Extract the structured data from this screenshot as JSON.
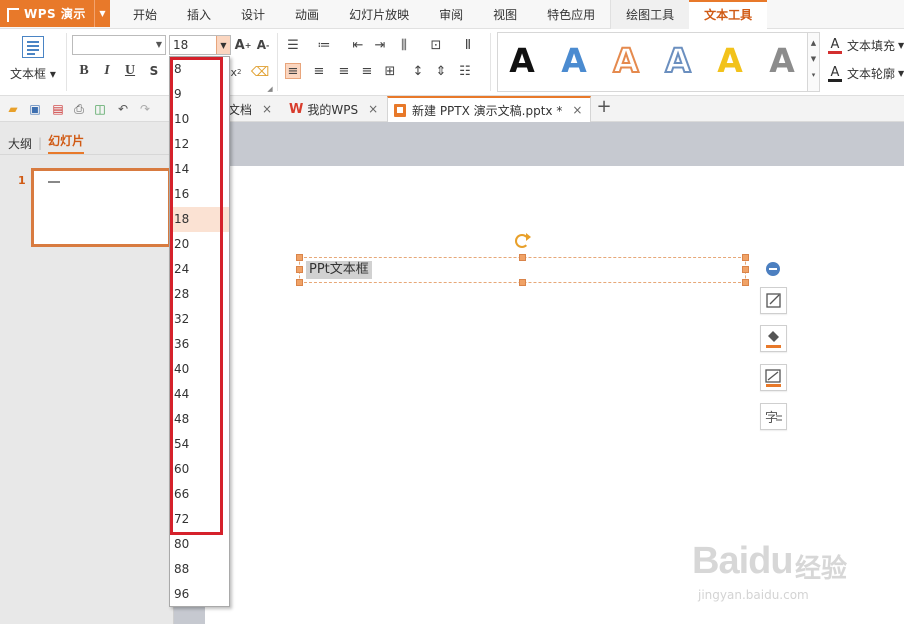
{
  "app": {
    "name": "WPS 演示"
  },
  "menu_tabs": [
    {
      "label": "开始",
      "kind": "normal"
    },
    {
      "label": "插入",
      "kind": "normal"
    },
    {
      "label": "设计",
      "kind": "normal"
    },
    {
      "label": "动画",
      "kind": "normal"
    },
    {
      "label": "幻灯片放映",
      "kind": "normal"
    },
    {
      "label": "审阅",
      "kind": "normal"
    },
    {
      "label": "视图",
      "kind": "normal"
    },
    {
      "label": "特色应用",
      "kind": "normal"
    },
    {
      "label": "绘图工具",
      "kind": "tool"
    },
    {
      "label": "文本工具",
      "kind": "active"
    }
  ],
  "ribbon": {
    "textbox_label": "文本框",
    "font_name": "",
    "font_size": "18",
    "format_buttons": {
      "bold": "B",
      "italic": "I",
      "underline": "U",
      "strike": "S"
    },
    "text_fill": "文本填充",
    "text_outline": "文本轮廓",
    "text_fill_color": "#d32f2f",
    "text_outline_color": "#222222",
    "art_styles": [
      {
        "glyph": "A",
        "style": "solid",
        "fill": "#111111",
        "stroke": "none"
      },
      {
        "glyph": "A",
        "style": "solid",
        "fill": "#4b8bd0",
        "stroke": "none"
      },
      {
        "glyph": "A",
        "style": "outline",
        "fill": "#ffffff",
        "stroke": "#e58a4e"
      },
      {
        "glyph": "A",
        "style": "outline",
        "fill": "#ffffff",
        "stroke": "#6b8fbf"
      },
      {
        "glyph": "A",
        "style": "solid",
        "fill": "#f2c21b",
        "stroke": "none"
      },
      {
        "glyph": "A",
        "style": "gradient",
        "fill": "#8c8c8c",
        "stroke": "none"
      }
    ]
  },
  "doc_tabs": {
    "partial": "文档",
    "wps": "我的WPS",
    "current": "新建 PPTX 演示文稿.pptx *"
  },
  "left_panel": {
    "tab_outline": "大纲",
    "tab_slides": "幻灯片",
    "slide_number": "1"
  },
  "slide": {
    "textbox_text": "PPt文本框"
  },
  "font_size_dropdown": {
    "selected": "18",
    "options": [
      "8",
      "9",
      "10",
      "12",
      "14",
      "16",
      "18",
      "20",
      "24",
      "28",
      "32",
      "36",
      "40",
      "44",
      "48",
      "54",
      "60",
      "66",
      "72",
      "80",
      "88",
      "96"
    ]
  },
  "watermark": {
    "brand": "Baidu",
    "cn": "经验",
    "url": "jingyan.baidu.com"
  }
}
